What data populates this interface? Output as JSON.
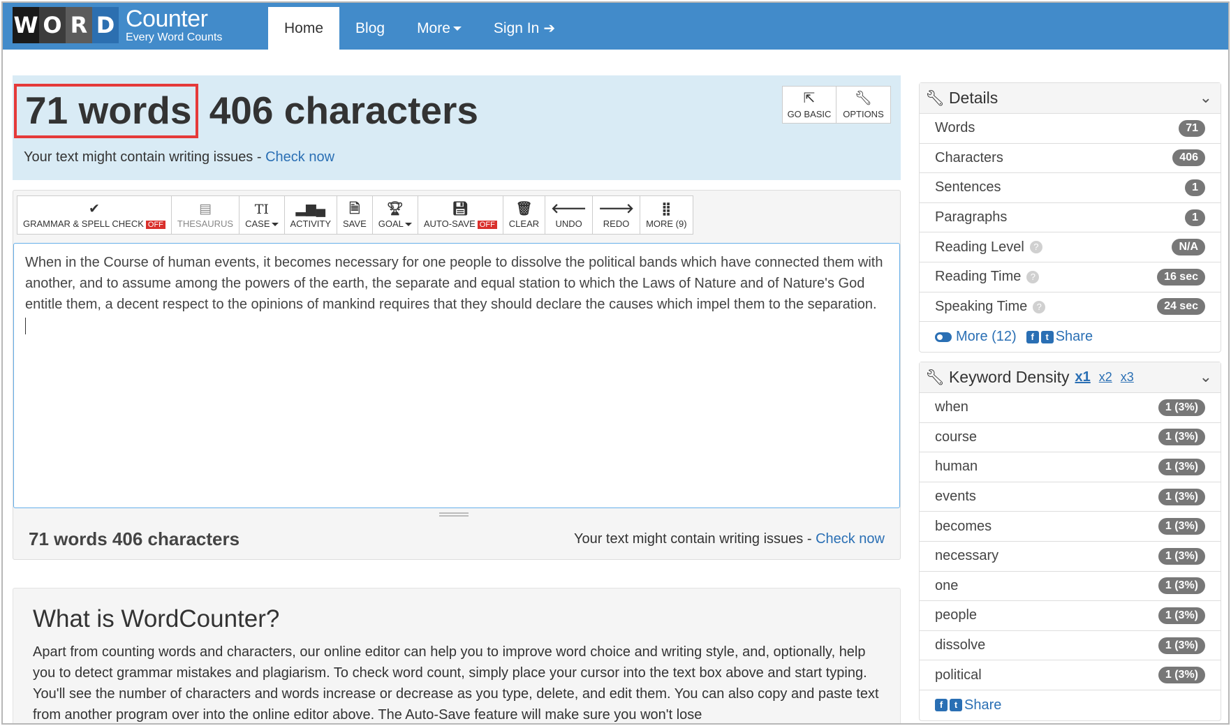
{
  "logo": {
    "letters": [
      "W",
      "O",
      "R",
      "D"
    ],
    "title": "Counter",
    "tagline": "Every Word Counts"
  },
  "nav": {
    "home": "Home",
    "blog": "Blog",
    "more": "More",
    "signin": "Sign In"
  },
  "hero": {
    "words": "71 words",
    "characters": "406 characters",
    "issue_text": "Your text might contain writing issues - ",
    "issue_link": "Check now",
    "go_basic": "GO BASIC",
    "options": "OPTIONS"
  },
  "toolbar": {
    "grammar": "GRAMMAR & SPELL CHECK",
    "grammar_state": "OFF",
    "thesaurus": "THESAURUS",
    "case": "CASE",
    "activity": "ACTIVITY",
    "save": "SAVE",
    "goal": "GOAL",
    "autosave": "AUTO-SAVE",
    "autosave_state": "OFF",
    "clear": "CLEAR",
    "undo": "UNDO",
    "redo": "REDO",
    "more": "MORE (9)"
  },
  "editor": {
    "text": "When in the Course of human events, it becomes necessary for one people to dissolve the political bands which have connected them with another, and to assume among the powers of the earth, the separate and equal station to which the Laws of Nature and of Nature's God entitle them, a decent respect to the opinions of mankind requires that they should declare the causes which impel them to the separation."
  },
  "footer_bar": {
    "count": "71 words 406 characters",
    "issue_text": "Your text might contain writing issues - ",
    "issue_link": "Check now"
  },
  "about": {
    "title": "What is WordCounter?",
    "body": "Apart from counting words and characters, our online editor can help you to improve word choice and writing style, and, optionally, help you to detect grammar mistakes and plagiarism. To check word count, simply place your cursor into the text box above and start typing. You'll see the number of characters and words increase or decrease as you type, delete, and edit them. You can also copy and paste text from another program over into the online editor above. The Auto-Save feature will make sure you won't lose"
  },
  "details": {
    "title": "Details",
    "rows": [
      {
        "label": "Words",
        "value": "71"
      },
      {
        "label": "Characters",
        "value": "406"
      },
      {
        "label": "Sentences",
        "value": "1"
      },
      {
        "label": "Paragraphs",
        "value": "1"
      },
      {
        "label": "Reading Level",
        "value": "N/A"
      },
      {
        "label": "Reading Time",
        "value": "16 sec"
      },
      {
        "label": "Speaking Time",
        "value": "24 sec"
      }
    ],
    "more": "More (12)",
    "share": "Share"
  },
  "keyword_density": {
    "title": "Keyword Density",
    "tabs": [
      "x1",
      "x2",
      "x3"
    ],
    "rows": [
      {
        "word": "when",
        "value": "1 (3%)"
      },
      {
        "word": "course",
        "value": "1 (3%)"
      },
      {
        "word": "human",
        "value": "1 (3%)"
      },
      {
        "word": "events",
        "value": "1 (3%)"
      },
      {
        "word": "becomes",
        "value": "1 (3%)"
      },
      {
        "word": "necessary",
        "value": "1 (3%)"
      },
      {
        "word": "one",
        "value": "1 (3%)"
      },
      {
        "word": "people",
        "value": "1 (3%)"
      },
      {
        "word": "dissolve",
        "value": "1 (3%)"
      },
      {
        "word": "political",
        "value": "1 (3%)"
      }
    ],
    "share": "Share"
  },
  "colors": {
    "navbar": "#428bca",
    "logo_tiles": [
      "#1a1a1a",
      "#3a3a3a",
      "#5a5a5a",
      "#2c6fb0"
    ],
    "hero_bg": "#d9ebf5",
    "highlight_box": "#e53a3a",
    "link": "#2a6fb4",
    "off_badge": "#d9302c"
  }
}
